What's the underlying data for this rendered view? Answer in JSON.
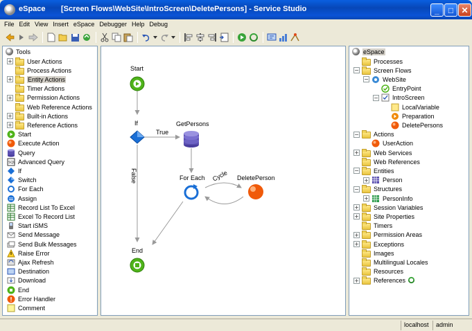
{
  "window": {
    "app_name": "eSpace",
    "title": "[Screen Flows\\WebSite\\IntroScreen\\DeletePersons] - Service Studio",
    "minimize": "_",
    "maximize": "□",
    "close": "✕"
  },
  "menu": [
    "File",
    "Edit",
    "View",
    "Insert",
    "eSpace",
    "Debugger",
    "Help",
    "Debug"
  ],
  "tools_panel": {
    "title": "Tools",
    "items": [
      {
        "label": "User Actions",
        "icon": "folder-icon",
        "expandable": true
      },
      {
        "label": "Process Actions",
        "icon": "folder-icon",
        "expandable": false
      },
      {
        "label": "Entity Actions",
        "icon": "folder-icon",
        "expandable": true
      },
      {
        "label": "Timer Actions",
        "icon": "folder-icon",
        "expandable": false
      },
      {
        "label": "Permission Actions",
        "icon": "folder-icon",
        "expandable": true
      },
      {
        "label": "Web Reference Actions",
        "icon": "folder-icon",
        "expandable": false
      },
      {
        "label": "Built-in Actions",
        "icon": "folder-icon",
        "expandable": true
      },
      {
        "label": "Reference Actions",
        "icon": "folder-icon",
        "expandable": true
      },
      {
        "label": "Start",
        "icon": "start-icon"
      },
      {
        "label": "Execute Action",
        "icon": "execute-action-icon"
      },
      {
        "label": "Query",
        "icon": "query-icon"
      },
      {
        "label": "Advanced Query",
        "icon": "advanced-query-icon"
      },
      {
        "label": "If",
        "icon": "if-icon"
      },
      {
        "label": "Switch",
        "icon": "switch-icon"
      },
      {
        "label": "For Each",
        "icon": "for-each-icon"
      },
      {
        "label": "Assign",
        "icon": "assign-icon"
      },
      {
        "label": "Record List To Excel",
        "icon": "excel-export-icon"
      },
      {
        "label": "Excel To Record List",
        "icon": "excel-import-icon"
      },
      {
        "label": "Start iSMS",
        "icon": "sms-icon"
      },
      {
        "label": "Send Message",
        "icon": "send-message-icon"
      },
      {
        "label": "Send Bulk Messages",
        "icon": "send-bulk-icon"
      },
      {
        "label": "Raise Error",
        "icon": "raise-error-icon"
      },
      {
        "label": "Ajax Refresh",
        "icon": "ajax-refresh-icon"
      },
      {
        "label": "Destination",
        "icon": "destination-icon"
      },
      {
        "label": "Download",
        "icon": "download-icon"
      },
      {
        "label": "End",
        "icon": "end-icon"
      },
      {
        "label": "Error Handler",
        "icon": "error-handler-icon"
      },
      {
        "label": "Comment",
        "icon": "comment-icon"
      }
    ]
  },
  "flow": {
    "start": "Start",
    "if": "If",
    "true": "True",
    "false": "False",
    "get_persons": "GetPersons",
    "for_each": "For Each",
    "cycle": "Cycle",
    "delete_person": "DeletePerson",
    "end": "End"
  },
  "espace_tree": {
    "root": "eSpace",
    "items": [
      {
        "label": "Processes",
        "depth": 1,
        "icon": "folder-icon",
        "exp": ""
      },
      {
        "label": "Screen Flows",
        "depth": 1,
        "icon": "folder-icon",
        "exp": "−"
      },
      {
        "label": "WebSite",
        "depth": 2,
        "icon": "screen-flow-icon",
        "exp": "−"
      },
      {
        "label": "EntryPoint",
        "depth": 3,
        "icon": "entry-point-icon",
        "exp": ""
      },
      {
        "label": "IntroScreen",
        "depth": 3,
        "icon": "screen-icon",
        "exp": "−"
      },
      {
        "label": "LocalVariable",
        "depth": 4,
        "icon": "local-variable-icon",
        "exp": ""
      },
      {
        "label": "Preparation",
        "depth": 4,
        "icon": "preparation-icon",
        "exp": ""
      },
      {
        "label": "DeletePersons",
        "depth": 4,
        "icon": "action-icon",
        "exp": ""
      },
      {
        "label": "Actions",
        "depth": 1,
        "icon": "folder-icon",
        "exp": "−"
      },
      {
        "label": "UserAction",
        "depth": 2,
        "icon": "action-icon",
        "exp": ""
      },
      {
        "label": "Web Services",
        "depth": 1,
        "icon": "folder-icon",
        "exp": "+"
      },
      {
        "label": "Web References",
        "depth": 1,
        "icon": "folder-icon",
        "exp": ""
      },
      {
        "label": "Entities",
        "depth": 1,
        "icon": "folder-icon",
        "exp": "−"
      },
      {
        "label": "Person",
        "depth": 2,
        "icon": "entity-icon",
        "exp": "+"
      },
      {
        "label": "Structures",
        "depth": 1,
        "icon": "folder-icon",
        "exp": "−"
      },
      {
        "label": "PersonInfo",
        "depth": 2,
        "icon": "structure-icon",
        "exp": "+"
      },
      {
        "label": "Session Variables",
        "depth": 1,
        "icon": "folder-icon",
        "exp": "+"
      },
      {
        "label": "Site Properties",
        "depth": 1,
        "icon": "folder-icon",
        "exp": "+"
      },
      {
        "label": "Timers",
        "depth": 1,
        "icon": "folder-icon",
        "exp": ""
      },
      {
        "label": "Permission Areas",
        "depth": 1,
        "icon": "folder-icon",
        "exp": "+"
      },
      {
        "label": "Exceptions",
        "depth": 1,
        "icon": "folder-icon",
        "exp": "+"
      },
      {
        "label": "Images",
        "depth": 1,
        "icon": "folder-icon",
        "exp": ""
      },
      {
        "label": "Multilingual Locales",
        "depth": 1,
        "icon": "folder-icon",
        "exp": ""
      },
      {
        "label": "Resources",
        "depth": 1,
        "icon": "folder-icon",
        "exp": ""
      },
      {
        "label": "References",
        "depth": 1,
        "icon": "folder-icon",
        "exp": "+"
      }
    ]
  },
  "status": {
    "server": "localhost",
    "user": "admin"
  },
  "colors": {
    "start_green": "#5cbf1f",
    "action_orange": "#f05a0a",
    "if_blue": "#1a6fd6",
    "query_purple": "#5a4fb0"
  }
}
